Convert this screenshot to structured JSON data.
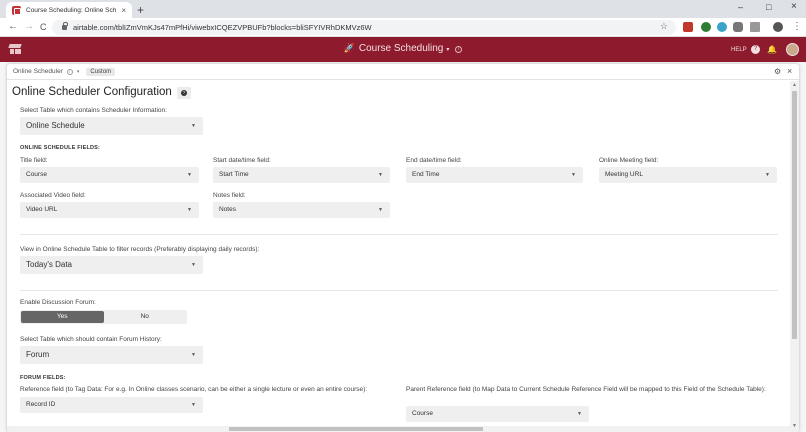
{
  "browser": {
    "tab_title": "Course Scheduling: Online Sche",
    "tab_close": "×",
    "newtab": "+",
    "url": "airtable.com/tblIZmVmKJs47mPfHi/viwebxICQEZVPBUFb?blocks=bliSFYIVRhDKMVz6W",
    "back": "←",
    "forward": "→",
    "reload": "C",
    "star": "☆",
    "minimize": "–",
    "maximize": "□",
    "close": "×",
    "menu": "⋮"
  },
  "app": {
    "base_title": "Course Scheduling",
    "caret": "▾",
    "help_label": "HELP",
    "help_glyph": "?",
    "bell_glyph": "🔔",
    "rocket_glyph": "🚀",
    "header_color": "#8e1b2d"
  },
  "panel": {
    "block_name": "Online Scheduler",
    "info_glyph": "i",
    "caret": "▾",
    "badge": "Custom",
    "gear": "⚙",
    "close": "×"
  },
  "config": {
    "title": "Online Scheduler Configuration",
    "help_glyph": "?",
    "table_prompt": "Select Table which contains Scheduler Information:",
    "table_value": "Online Schedule",
    "fields_heading": "ONLINE SCHEDULE FIELDS:",
    "title_label": "Title field:",
    "title_value": "Course",
    "start_label": "Start date/time field:",
    "start_value": "Start Time",
    "end_label": "End date/time field:",
    "end_value": "End Time",
    "meeting_label": "Online Meeting field:",
    "meeting_value": "Meeting URL",
    "video_label": "Associated Video field:",
    "video_value": "Video URL",
    "notes_label": "Notes field:",
    "notes_value": "Notes",
    "view_prompt": "View in Online Schedule Table to filter records (Preferably displaying daily records):",
    "view_value": "Today's Data",
    "forum_prompt": "Enable Discussion Forum:",
    "forum_yes": "Yes",
    "forum_no": "No",
    "forum_selected": "Yes",
    "history_prompt": "Select Table which should contain Forum History:",
    "history_value": "Forum",
    "forum_heading": "FORUM FIELDS:",
    "ref_label": "Reference field (to Tag Data: For e.g. In Online classes scenario, can be either a single lecture or even an entire course):",
    "ref_value": "Record ID",
    "parent_label": "Parent Reference field (to Map Data to Current Schedule Reference Field will be mapped to this Field of the Schedule Table):",
    "parent_value": "Course",
    "dropdown_arrow": "▼"
  }
}
